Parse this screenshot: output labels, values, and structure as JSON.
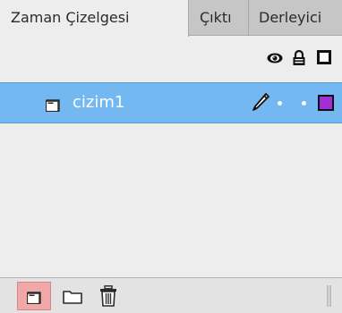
{
  "tabs": [
    {
      "label": "Zaman Çizelgesi",
      "active": true
    },
    {
      "label": "Çıktı",
      "active": false
    },
    {
      "label": "Derleyici",
      "active": false
    }
  ],
  "header_icons": [
    "eye-icon",
    "lock-icon",
    "outline-icon"
  ],
  "layers": [
    {
      "name": "cizim1",
      "selected": true,
      "icons": [
        "layer-icon",
        "pencil-icon"
      ],
      "color": "#a02fd6"
    }
  ],
  "bottom_toolbar": [
    "new-layer-icon",
    "new-folder-icon",
    "delete-icon"
  ],
  "colors": {
    "selection": "#74b8f2",
    "panel_bg": "#ededed",
    "tab_bar": "#c6c6c6",
    "active_button": "#f0a8a8"
  }
}
